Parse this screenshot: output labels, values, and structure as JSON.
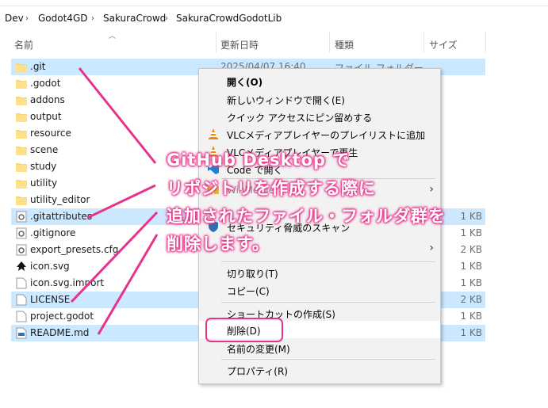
{
  "breadcrumb": [
    "Dev",
    "Godot4GD",
    "SakuraCrowd",
    "SakuraCrowdGodotLib"
  ],
  "columns": {
    "name": "名前",
    "date": "更新日時",
    "type": "種類",
    "size": "サイズ"
  },
  "files": [
    {
      "name": ".git",
      "icon": "folder-icon",
      "date": "2025/04/07 16:40",
      "type": "ファイル フォルダー",
      "size": "",
      "selected": true
    },
    {
      "name": ".godot",
      "icon": "folder-icon",
      "date": "",
      "type": "",
      "size": "",
      "selected": false
    },
    {
      "name": "addons",
      "icon": "folder-icon",
      "date": "",
      "type": "",
      "size": "",
      "selected": false
    },
    {
      "name": "output",
      "icon": "folder-icon",
      "date": "",
      "type": "",
      "size": "",
      "selected": false
    },
    {
      "name": "resource",
      "icon": "folder-icon",
      "date": "",
      "type": "",
      "size": "",
      "selected": false
    },
    {
      "name": "scene",
      "icon": "folder-icon",
      "date": "",
      "type": "",
      "size": "",
      "selected": false
    },
    {
      "name": "study",
      "icon": "folder-icon",
      "date": "",
      "type": "",
      "size": "",
      "selected": false
    },
    {
      "name": "utility",
      "icon": "folder-icon",
      "date": "",
      "type": "",
      "size": "",
      "selected": false
    },
    {
      "name": "utility_editor",
      "icon": "folder-icon",
      "date": "",
      "type": "",
      "size": "",
      "selected": false
    },
    {
      "name": ".gitattributes",
      "icon": "settings-file-icon",
      "date": "",
      "type": "",
      "size": "1 KB",
      "selected": true
    },
    {
      "name": ".gitignore",
      "icon": "settings-file-icon",
      "date": "",
      "type": "",
      "size": "1 KB",
      "selected": false
    },
    {
      "name": "export_presets.cfg",
      "icon": "settings-file-icon",
      "date": "",
      "type": "",
      "size": "2 KB",
      "selected": false
    },
    {
      "name": "icon.svg",
      "icon": "inkscape-icon",
      "date": "",
      "type": "",
      "size": "1 KB",
      "selected": false
    },
    {
      "name": "icon.svg.import",
      "icon": "file-icon",
      "date": "",
      "type": "",
      "size": "1 KB",
      "selected": false
    },
    {
      "name": "LICENSE",
      "icon": "file-icon",
      "date": "",
      "type": "",
      "size": "2 KB",
      "selected": true
    },
    {
      "name": "project.godot",
      "icon": "file-icon",
      "date": "",
      "type": "",
      "size": "1 KB",
      "selected": false
    },
    {
      "name": "README.md",
      "icon": "markdown-file-icon",
      "date": "",
      "type": "",
      "size": "1 KB",
      "selected": true
    }
  ],
  "context_menu": {
    "items": [
      {
        "label": "開く(O)",
        "bold": true,
        "icon": "",
        "arrow": false
      },
      {
        "label": "新しいウィンドウで開く(E)",
        "icon": "",
        "arrow": false
      },
      {
        "label": "クイック アクセスにピン留めする",
        "icon": "",
        "arrow": false
      },
      {
        "label": "VLCメディアプレイヤーのプレイリストに追加",
        "icon": "vlc-icon",
        "arrow": false
      },
      {
        "label": "VLCメディアプレイヤーで再生",
        "icon": "vlc-icon",
        "arrow": false
      },
      {
        "label": "Code で開く",
        "icon": "vscode-icon",
        "arrow": false
      },
      {
        "label": "WinMerge",
        "icon": "winmerge-icon",
        "arrow": true
      },
      {
        "label": "セキュリティ脅威のスキャン",
        "icon": "shield-icon",
        "arrow": false
      },
      {
        "label": "",
        "icon": "",
        "arrow": true
      },
      {
        "label": "切り取り(T)",
        "icon": "",
        "arrow": false
      },
      {
        "label": "コピー(C)",
        "icon": "",
        "arrow": false
      },
      {
        "label": "ショートカットの作成(S)",
        "icon": "",
        "arrow": false
      },
      {
        "label": "削除(D)",
        "icon": "",
        "arrow": false,
        "hover": true
      },
      {
        "label": "名前の変更(M)",
        "icon": "",
        "arrow": false
      },
      {
        "label": "プロパティ(R)",
        "icon": "",
        "arrow": false
      }
    ]
  },
  "annotation": {
    "lines": [
      "GitHub Desktop で",
      "リポジトリを作成する際に",
      "追加されたファイル・フォルダ群を",
      "削除します。"
    ],
    "color": "#e8338a"
  },
  "colors": {
    "selection": "#cce8ff",
    "folder": "#f8d775",
    "accent": "#e8338a"
  }
}
